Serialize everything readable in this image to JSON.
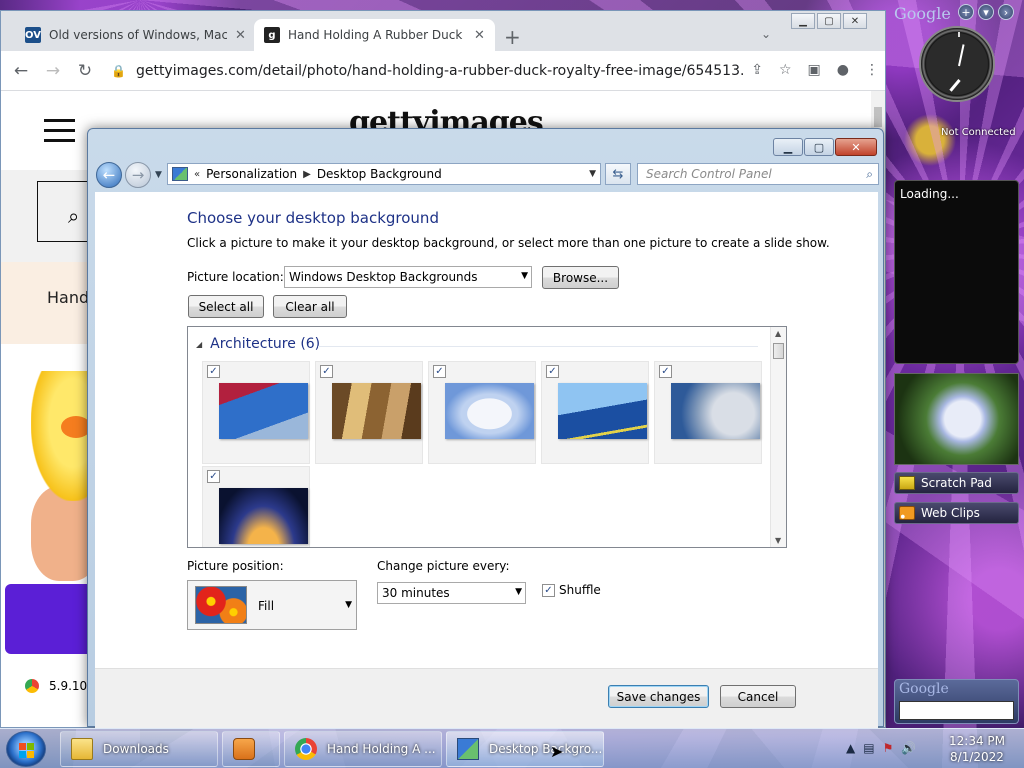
{
  "browser": {
    "tabs": [
      {
        "favicon": "OV",
        "title": "Old versions of Windows, Mac an"
      },
      {
        "favicon": "g",
        "title": "Hand Holding A Rubber Duck Ro"
      }
    ],
    "url": "gettyimages.com/detail/photo/hand-holding-a-rubber-duck-royalty-free-image/654513...",
    "page": {
      "logo": "gettyimages",
      "hand_text": "Hand",
      "chrome_version": "5.9.10"
    }
  },
  "control_panel": {
    "breadcrumb": [
      "Personalization",
      "Desktop Background"
    ],
    "search_placeholder": "Search Control Panel",
    "heading": "Choose your desktop background",
    "description": "Click a picture to make it your desktop background, or select more than one picture to create a slide show.",
    "picture_location_label": "Picture location:",
    "picture_location_value": "Windows Desktop Backgrounds",
    "browse_label": "Browse...",
    "select_all_label": "Select all",
    "clear_all_label": "Clear all",
    "group_label": "Architecture (6)",
    "thumbnails": [
      {
        "checked": true
      },
      {
        "checked": true
      },
      {
        "checked": true
      },
      {
        "checked": true
      },
      {
        "checked": true
      },
      {
        "checked": true
      }
    ],
    "picture_position_label": "Picture position:",
    "picture_position_value": "Fill",
    "change_picture_label": "Change picture every:",
    "change_picture_value": "30 minutes",
    "shuffle_label": "Shuffle",
    "shuffle_checked": true,
    "save_label": "Save changes",
    "cancel_label": "Cancel"
  },
  "gadgets": {
    "google_label": "Google",
    "not_connected": "Not Connected",
    "loading": "Loading...",
    "scratch_pad": "Scratch Pad",
    "web_clips": "Web Clips",
    "google_search_label": "Google"
  },
  "taskbar": {
    "items": [
      {
        "label": "Downloads"
      },
      {
        "label": ""
      },
      {
        "label": "Hand Holding A ..."
      },
      {
        "label": "Desktop Backgro..."
      }
    ],
    "time": "12:34 PM",
    "date": "8/1/2022"
  }
}
